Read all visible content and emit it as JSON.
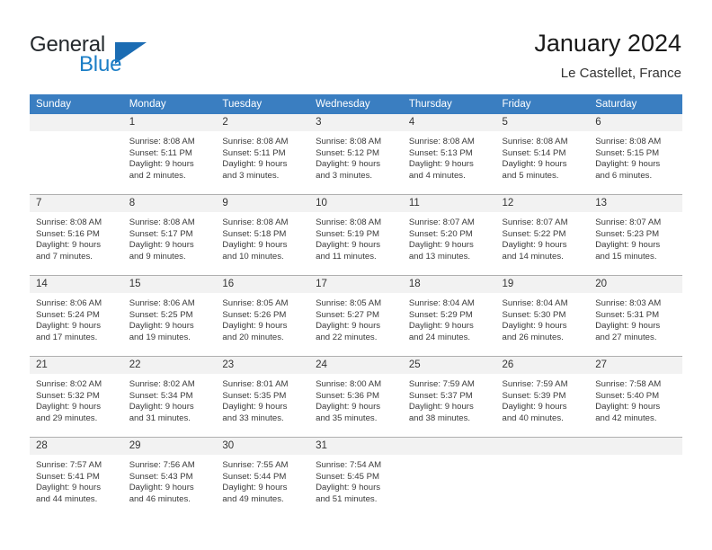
{
  "brand": {
    "name_part1": "General",
    "name_part2": "Blue",
    "logo_icon": "triangle-logo-icon"
  },
  "header": {
    "title": "January 2024",
    "location": "Le Castellet, France"
  },
  "calendar": {
    "weekday_headers": [
      "Sunday",
      "Monday",
      "Tuesday",
      "Wednesday",
      "Thursday",
      "Friday",
      "Saturday"
    ],
    "accent_color": "#3a7ec1",
    "daynum_band_color": "#f2f2f2",
    "weeks": [
      [
        {
          "day": "",
          "sunrise": "",
          "sunset": "",
          "daylight_line1": "",
          "daylight_line2": ""
        },
        {
          "day": "1",
          "sunrise": "Sunrise: 8:08 AM",
          "sunset": "Sunset: 5:11 PM",
          "daylight_line1": "Daylight: 9 hours",
          "daylight_line2": "and 2 minutes."
        },
        {
          "day": "2",
          "sunrise": "Sunrise: 8:08 AM",
          "sunset": "Sunset: 5:11 PM",
          "daylight_line1": "Daylight: 9 hours",
          "daylight_line2": "and 3 minutes."
        },
        {
          "day": "3",
          "sunrise": "Sunrise: 8:08 AM",
          "sunset": "Sunset: 5:12 PM",
          "daylight_line1": "Daylight: 9 hours",
          "daylight_line2": "and 3 minutes."
        },
        {
          "day": "4",
          "sunrise": "Sunrise: 8:08 AM",
          "sunset": "Sunset: 5:13 PM",
          "daylight_line1": "Daylight: 9 hours",
          "daylight_line2": "and 4 minutes."
        },
        {
          "day": "5",
          "sunrise": "Sunrise: 8:08 AM",
          "sunset": "Sunset: 5:14 PM",
          "daylight_line1": "Daylight: 9 hours",
          "daylight_line2": "and 5 minutes."
        },
        {
          "day": "6",
          "sunrise": "Sunrise: 8:08 AM",
          "sunset": "Sunset: 5:15 PM",
          "daylight_line1": "Daylight: 9 hours",
          "daylight_line2": "and 6 minutes."
        }
      ],
      [
        {
          "day": "7",
          "sunrise": "Sunrise: 8:08 AM",
          "sunset": "Sunset: 5:16 PM",
          "daylight_line1": "Daylight: 9 hours",
          "daylight_line2": "and 7 minutes."
        },
        {
          "day": "8",
          "sunrise": "Sunrise: 8:08 AM",
          "sunset": "Sunset: 5:17 PM",
          "daylight_line1": "Daylight: 9 hours",
          "daylight_line2": "and 9 minutes."
        },
        {
          "day": "9",
          "sunrise": "Sunrise: 8:08 AM",
          "sunset": "Sunset: 5:18 PM",
          "daylight_line1": "Daylight: 9 hours",
          "daylight_line2": "and 10 minutes."
        },
        {
          "day": "10",
          "sunrise": "Sunrise: 8:08 AM",
          "sunset": "Sunset: 5:19 PM",
          "daylight_line1": "Daylight: 9 hours",
          "daylight_line2": "and 11 minutes."
        },
        {
          "day": "11",
          "sunrise": "Sunrise: 8:07 AM",
          "sunset": "Sunset: 5:20 PM",
          "daylight_line1": "Daylight: 9 hours",
          "daylight_line2": "and 13 minutes."
        },
        {
          "day": "12",
          "sunrise": "Sunrise: 8:07 AM",
          "sunset": "Sunset: 5:22 PM",
          "daylight_line1": "Daylight: 9 hours",
          "daylight_line2": "and 14 minutes."
        },
        {
          "day": "13",
          "sunrise": "Sunrise: 8:07 AM",
          "sunset": "Sunset: 5:23 PM",
          "daylight_line1": "Daylight: 9 hours",
          "daylight_line2": "and 15 minutes."
        }
      ],
      [
        {
          "day": "14",
          "sunrise": "Sunrise: 8:06 AM",
          "sunset": "Sunset: 5:24 PM",
          "daylight_line1": "Daylight: 9 hours",
          "daylight_line2": "and 17 minutes."
        },
        {
          "day": "15",
          "sunrise": "Sunrise: 8:06 AM",
          "sunset": "Sunset: 5:25 PM",
          "daylight_line1": "Daylight: 9 hours",
          "daylight_line2": "and 19 minutes."
        },
        {
          "day": "16",
          "sunrise": "Sunrise: 8:05 AM",
          "sunset": "Sunset: 5:26 PM",
          "daylight_line1": "Daylight: 9 hours",
          "daylight_line2": "and 20 minutes."
        },
        {
          "day": "17",
          "sunrise": "Sunrise: 8:05 AM",
          "sunset": "Sunset: 5:27 PM",
          "daylight_line1": "Daylight: 9 hours",
          "daylight_line2": "and 22 minutes."
        },
        {
          "day": "18",
          "sunrise": "Sunrise: 8:04 AM",
          "sunset": "Sunset: 5:29 PM",
          "daylight_line1": "Daylight: 9 hours",
          "daylight_line2": "and 24 minutes."
        },
        {
          "day": "19",
          "sunrise": "Sunrise: 8:04 AM",
          "sunset": "Sunset: 5:30 PM",
          "daylight_line1": "Daylight: 9 hours",
          "daylight_line2": "and 26 minutes."
        },
        {
          "day": "20",
          "sunrise": "Sunrise: 8:03 AM",
          "sunset": "Sunset: 5:31 PM",
          "daylight_line1": "Daylight: 9 hours",
          "daylight_line2": "and 27 minutes."
        }
      ],
      [
        {
          "day": "21",
          "sunrise": "Sunrise: 8:02 AM",
          "sunset": "Sunset: 5:32 PM",
          "daylight_line1": "Daylight: 9 hours",
          "daylight_line2": "and 29 minutes."
        },
        {
          "day": "22",
          "sunrise": "Sunrise: 8:02 AM",
          "sunset": "Sunset: 5:34 PM",
          "daylight_line1": "Daylight: 9 hours",
          "daylight_line2": "and 31 minutes."
        },
        {
          "day": "23",
          "sunrise": "Sunrise: 8:01 AM",
          "sunset": "Sunset: 5:35 PM",
          "daylight_line1": "Daylight: 9 hours",
          "daylight_line2": "and 33 minutes."
        },
        {
          "day": "24",
          "sunrise": "Sunrise: 8:00 AM",
          "sunset": "Sunset: 5:36 PM",
          "daylight_line1": "Daylight: 9 hours",
          "daylight_line2": "and 35 minutes."
        },
        {
          "day": "25",
          "sunrise": "Sunrise: 7:59 AM",
          "sunset": "Sunset: 5:37 PM",
          "daylight_line1": "Daylight: 9 hours",
          "daylight_line2": "and 38 minutes."
        },
        {
          "day": "26",
          "sunrise": "Sunrise: 7:59 AM",
          "sunset": "Sunset: 5:39 PM",
          "daylight_line1": "Daylight: 9 hours",
          "daylight_line2": "and 40 minutes."
        },
        {
          "day": "27",
          "sunrise": "Sunrise: 7:58 AM",
          "sunset": "Sunset: 5:40 PM",
          "daylight_line1": "Daylight: 9 hours",
          "daylight_line2": "and 42 minutes."
        }
      ],
      [
        {
          "day": "28",
          "sunrise": "Sunrise: 7:57 AM",
          "sunset": "Sunset: 5:41 PM",
          "daylight_line1": "Daylight: 9 hours",
          "daylight_line2": "and 44 minutes."
        },
        {
          "day": "29",
          "sunrise": "Sunrise: 7:56 AM",
          "sunset": "Sunset: 5:43 PM",
          "daylight_line1": "Daylight: 9 hours",
          "daylight_line2": "and 46 minutes."
        },
        {
          "day": "30",
          "sunrise": "Sunrise: 7:55 AM",
          "sunset": "Sunset: 5:44 PM",
          "daylight_line1": "Daylight: 9 hours",
          "daylight_line2": "and 49 minutes."
        },
        {
          "day": "31",
          "sunrise": "Sunrise: 7:54 AM",
          "sunset": "Sunset: 5:45 PM",
          "daylight_line1": "Daylight: 9 hours",
          "daylight_line2": "and 51 minutes."
        },
        {
          "day": "",
          "sunrise": "",
          "sunset": "",
          "daylight_line1": "",
          "daylight_line2": ""
        },
        {
          "day": "",
          "sunrise": "",
          "sunset": "",
          "daylight_line1": "",
          "daylight_line2": ""
        },
        {
          "day": "",
          "sunrise": "",
          "sunset": "",
          "daylight_line1": "",
          "daylight_line2": ""
        }
      ]
    ]
  }
}
